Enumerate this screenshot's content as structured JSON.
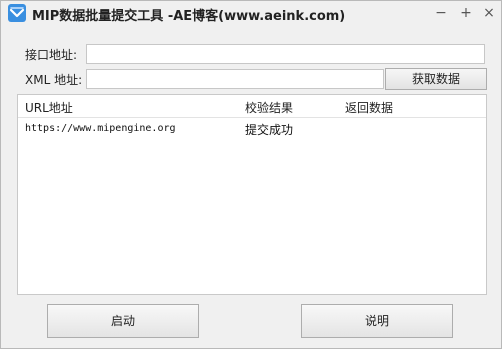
{
  "window": {
    "title": "MIP数据批量提交工具 -AE博客(www.aeink.com)",
    "icon": "app-logo-icon",
    "controls": {
      "minimize": "−",
      "maximize": "+",
      "close": "×"
    }
  },
  "form": {
    "api_label": "接口地址:",
    "api_value": "",
    "xml_label": "XML 地址:",
    "xml_value": "",
    "fetch_button": "获取数据"
  },
  "table": {
    "columns": [
      "URL地址",
      "校验结果",
      "返回数据"
    ],
    "rows": [
      {
        "url": "https://www.mipengine.org",
        "status": "提交成功",
        "response": ""
      }
    ]
  },
  "footer": {
    "start_button": "启动",
    "help_button": "说明"
  },
  "colors": {
    "window_bg": "#f0f0f0",
    "app_icon": "#3a8fe0"
  }
}
